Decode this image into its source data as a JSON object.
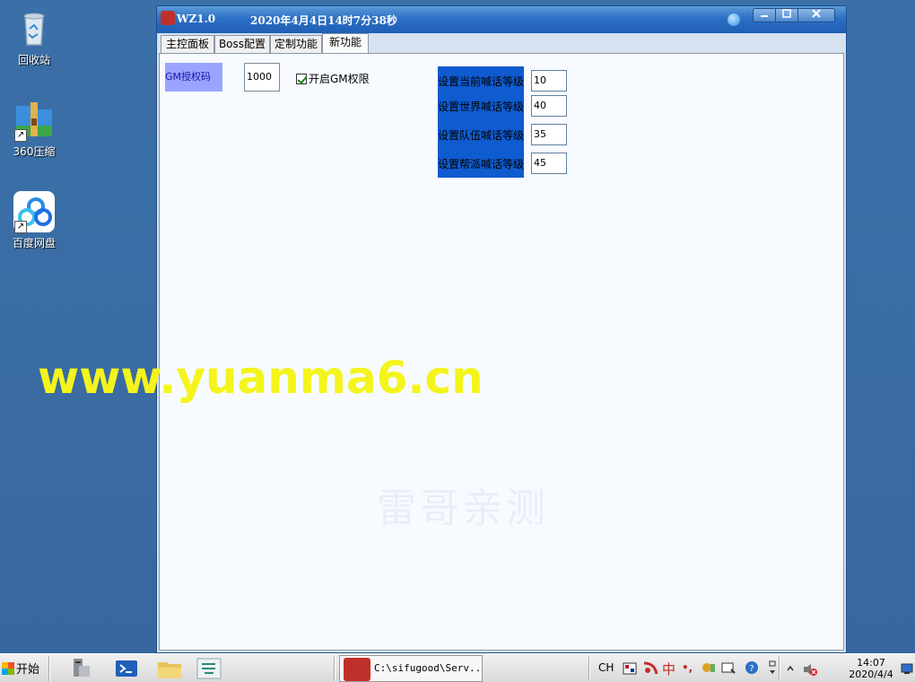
{
  "desktop": {
    "icons": [
      {
        "label": "回收站"
      },
      {
        "label": "360压缩"
      },
      {
        "label": "百度网盘"
      }
    ]
  },
  "window": {
    "title": "WZ1.0",
    "datetime": "2020年4月4日14时7分38秒",
    "tabs": [
      {
        "label": "主控面板"
      },
      {
        "label": "Boss配置"
      },
      {
        "label": "定制功能"
      },
      {
        "label": "新功能"
      }
    ],
    "active_tab": "新功能",
    "gm": {
      "label": "GM授权码",
      "code": "1000",
      "checkbox_label": "开启GM权限",
      "checked": true
    },
    "chat_levels": [
      {
        "label": "设置当前喊话等级",
        "value": "10"
      },
      {
        "label": "设置世界喊话等级",
        "value": "40"
      },
      {
        "label": "设置队伍喊话等级",
        "value": "35"
      },
      {
        "label": "设置帮派喊话等级",
        "value": "45"
      }
    ]
  },
  "watermarks": {
    "url": "www.yuanma6.cn",
    "cn": "雷哥亲测"
  },
  "taskbar": {
    "start_label": "开始",
    "task_label": "C:\\sifugood\\Serv...",
    "tray": {
      "lang": "CH",
      "ime": "中",
      "punct": "•,",
      "help": "?"
    },
    "clock_time": "14:07",
    "clock_date": "2020/4/4"
  },
  "colors": {
    "desktop": "#3a6ea5",
    "gm_label_bg": "#9aa4ff",
    "chat_panel_bg": "#0f5bd0",
    "watermark_url": "#f4f41c"
  }
}
